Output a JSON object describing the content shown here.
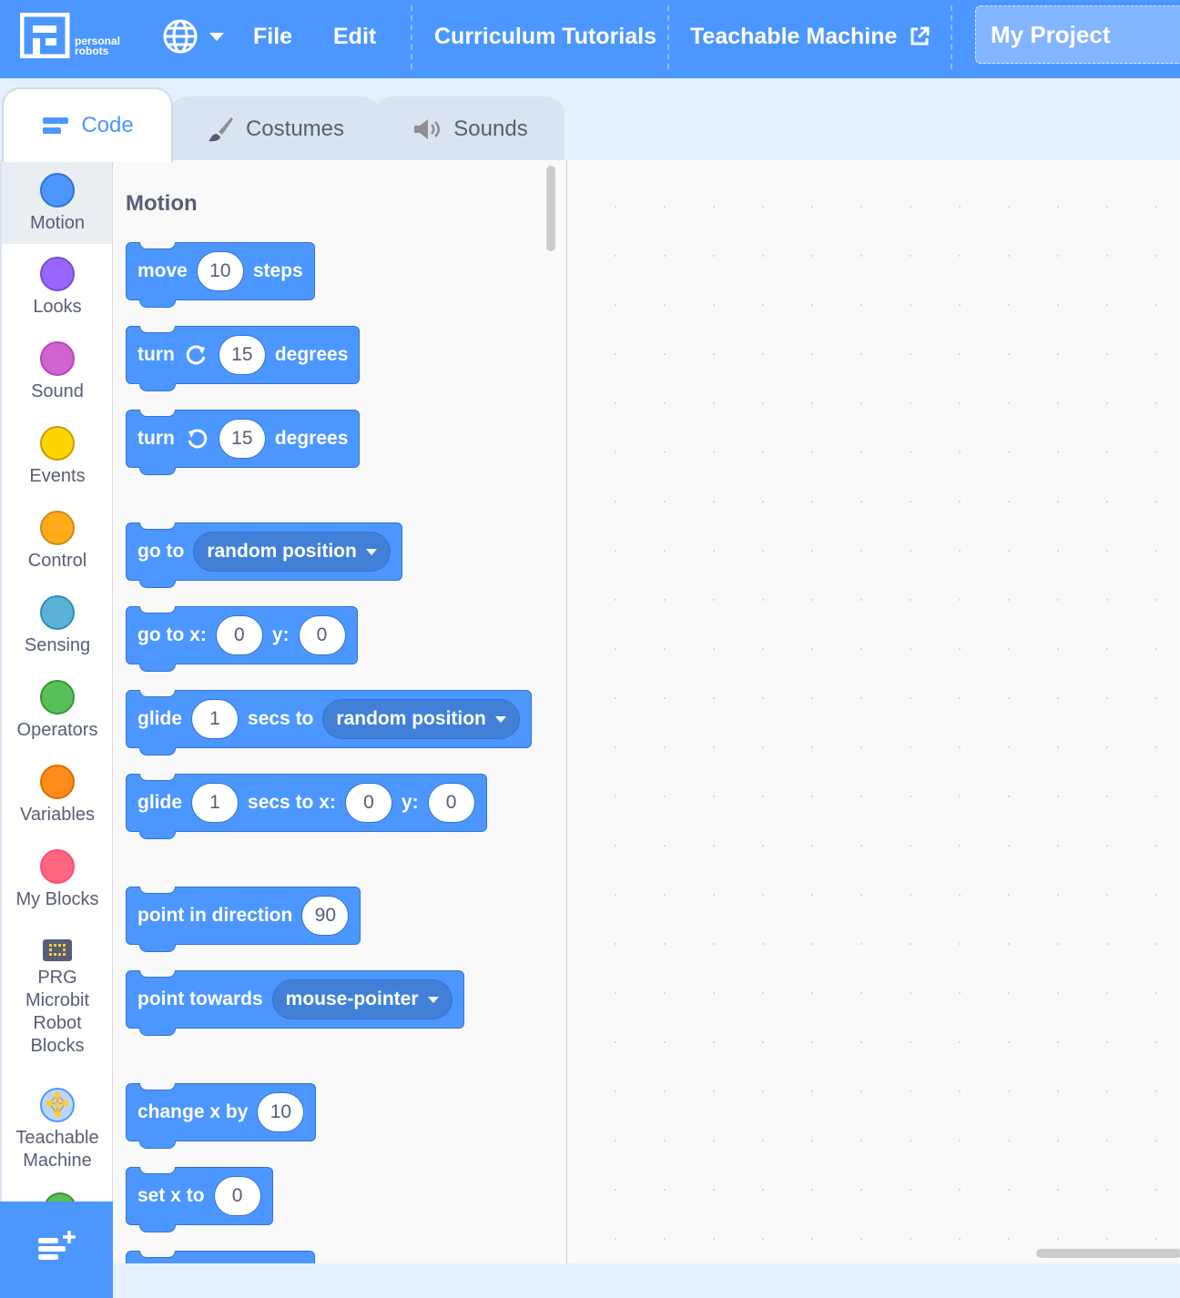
{
  "menubar": {
    "logo_line1": "personal",
    "logo_line2": "robots",
    "file": "File",
    "edit": "Edit",
    "tutorials": "Curriculum Tutorials",
    "teachable": "Teachable Machine",
    "project": "My Project"
  },
  "tabs": {
    "code": "Code",
    "costumes": "Costumes",
    "sounds": "Sounds"
  },
  "categories": [
    {
      "label": "Motion",
      "color": "#4c97ff"
    },
    {
      "label": "Looks",
      "color": "#9966ff"
    },
    {
      "label": "Sound",
      "color": "#cf63cf"
    },
    {
      "label": "Events",
      "color": "#ffd500"
    },
    {
      "label": "Control",
      "color": "#ffab19"
    },
    {
      "label": "Sensing",
      "color": "#5cb1d6"
    },
    {
      "label": "Operators",
      "color": "#59c059"
    },
    {
      "label": "Variables",
      "color": "#ff8c1a"
    },
    {
      "label": "My Blocks",
      "color": "#ff6680"
    },
    {
      "label": "PRG Microbit Robot Blocks"
    },
    {
      "label": "Teachable Machine"
    }
  ],
  "palette": {
    "title": "Motion",
    "move": {
      "a": "move",
      "v": "10",
      "b": "steps"
    },
    "turn_right": {
      "a": "turn",
      "v": "15",
      "b": "degrees"
    },
    "turn_left": {
      "a": "turn",
      "v": "15",
      "b": "degrees"
    },
    "goto": {
      "a": "go to",
      "menu": "random position"
    },
    "goto_xy": {
      "a": "go to x:",
      "x": "0",
      "b": "y:",
      "y": "0"
    },
    "glide_to": {
      "a": "glide",
      "v": "1",
      "b": "secs to",
      "menu": "random position"
    },
    "glide_xy": {
      "a": "glide",
      "v": "1",
      "b": "secs to x:",
      "x": "0",
      "c": "y:",
      "y": "0"
    },
    "point_dir": {
      "a": "point in direction",
      "v": "90"
    },
    "point_towards": {
      "a": "point towards",
      "menu": "mouse-pointer"
    },
    "change_x": {
      "a": "change x by",
      "v": "10"
    },
    "set_x": {
      "a": "set x to",
      "v": "0"
    }
  }
}
